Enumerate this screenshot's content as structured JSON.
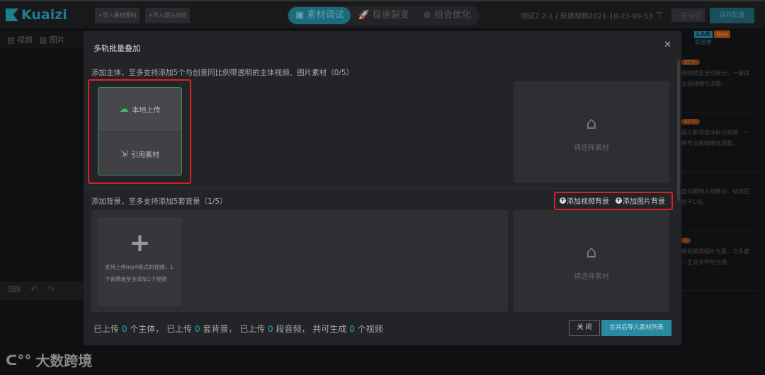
{
  "topbar": {
    "logo": "Kuaizi",
    "import_raw": "+导入素材原料",
    "import_group": "+导入镜头分组",
    "modes": [
      "素材调试",
      "极速裂变",
      "组合优化"
    ],
    "project": "测试7.2-1",
    "separator": "/",
    "video_name": "新建视频2021-10-21-09-53",
    "safe_zone": "安全区",
    "save": "保存配置"
  },
  "subbar": {
    "video": "视频",
    "image": "图片"
  },
  "lab": {
    "badge": "LAB",
    "label": "实验室",
    "new": "New"
  },
  "right_panel": [
    {
      "badge": "BETA",
      "lines": [
        "逐帧转显自动拆分，一键保",
        "业级精细化调整。"
      ]
    },
    {
      "badge": "BETA",
      "lines": [
        "语义断句自动拆分视频，一",
        "供专业级精细化调整。"
      ]
    },
    {
      "badge": "",
      "lines": [
        "自动跟随人物移动，动态匹",
        "处于C位。"
      ]
    },
    {
      "badge": "A",
      "lines": [
        "体视频或图片元素，与多套",
        "，生成多样化分镜。"
      ]
    }
  ],
  "modal": {
    "title": "多轨批量叠加",
    "subject_label": "添加主体，至多支持添加5个与创意同比例带透明的主体视频、图片素材（0/5）",
    "local_upload": "本地上传",
    "reference": "引用素材",
    "select_placeholder": "请选择素材",
    "bg_label": "添加背景，至多支持添加5套背景（1/5）",
    "add_video_bg": "添加视频背景",
    "add_image_bg": "添加图片背景",
    "bg_hint": "支持上传mp4格式的视频，1个背景组至多添加1个视频",
    "summary": {
      "p1": "已上传 ",
      "subjects": "0",
      "p2": " 个主体， 已上传 ",
      "backgrounds": "0",
      "p3": " 套背景， 已上传 ",
      "audios": "0",
      "p4": " 段音频， 共可生成 ",
      "videos": "0",
      "p5": " 个视频"
    },
    "close_btn": "关 闭",
    "merge_btn": "合并后导入素材列表"
  },
  "watermark": "大数跨境"
}
